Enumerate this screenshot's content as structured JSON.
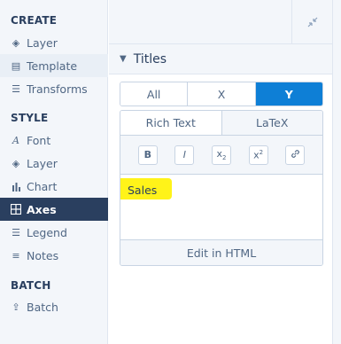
{
  "sidebar": {
    "sections": [
      {
        "title": "CREATE",
        "items": [
          {
            "label": "Layer",
            "icon": "layers-icon"
          },
          {
            "label": "Template",
            "icon": "template-icon"
          },
          {
            "label": "Transforms",
            "icon": "list-icon"
          }
        ]
      },
      {
        "title": "STYLE",
        "items": [
          {
            "label": "Font",
            "icon": "font-icon"
          },
          {
            "label": "Layer",
            "icon": "layers-icon"
          },
          {
            "label": "Chart",
            "icon": "chart-icon"
          },
          {
            "label": "Axes",
            "icon": "grid-icon"
          },
          {
            "label": "Legend",
            "icon": "list-icon"
          },
          {
            "label": "Notes",
            "icon": "notes-icon"
          }
        ]
      },
      {
        "title": "BATCH",
        "items": [
          {
            "label": "Batch",
            "icon": "batch-icon"
          }
        ]
      }
    ],
    "active_item": "Axes",
    "hover_item": "Template"
  },
  "panel": {
    "section_title": "Titles",
    "axis_options": [
      "All",
      "X",
      "Y"
    ],
    "selected_axis": "Y",
    "editor": {
      "tabs": [
        "Rich Text",
        "LaTeX"
      ],
      "active_tab": "Rich Text",
      "toolbar": [
        "B",
        "I",
        "x2",
        "x2",
        "link"
      ],
      "content": "Sales",
      "footer": "Edit in HTML"
    }
  },
  "colors": {
    "accent": "#0e7fd6",
    "active_nav": "#2a3f5f",
    "highlight": "#fff200"
  }
}
